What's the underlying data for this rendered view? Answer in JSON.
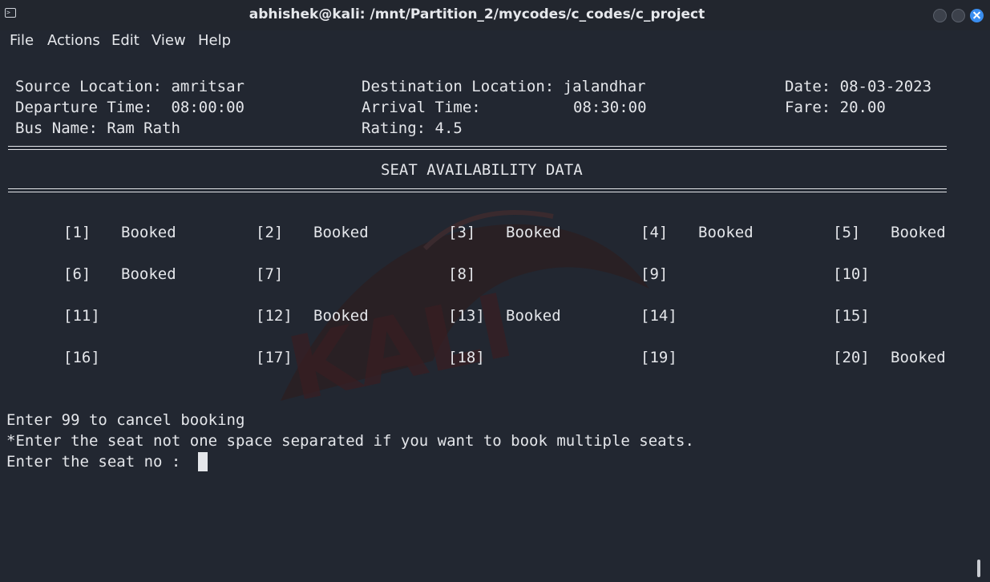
{
  "window": {
    "title": "abhishek@kali: /mnt/Partition_2/mycodes/c_codes/c_project"
  },
  "menu": {
    "file": "File",
    "actions": "Actions",
    "edit": "Edit",
    "view": "View",
    "help": "Help"
  },
  "trip": {
    "source": "Source Location: amritsar",
    "destination": "Destination Location: jalandhar",
    "date": "Date: 08-03-2023",
    "departure": "Departure Time:  08:00:00",
    "arrival_label": "Arrival Time:",
    "arrival_value": "08:30:00",
    "fare": "Fare: 20.00",
    "bus_name": "Bus Name: Ram Rath",
    "rating": "Rating: 4.5"
  },
  "section_title": "SEAT AVAILABILITY DATA",
  "seats": [
    {
      "no": "[1]",
      "status": "Booked"
    },
    {
      "no": "[2]",
      "status": "Booked"
    },
    {
      "no": "[3]",
      "status": "Booked"
    },
    {
      "no": "[4]",
      "status": "Booked"
    },
    {
      "no": "[5]",
      "status": "Booked"
    },
    {
      "no": "[6]",
      "status": "Booked"
    },
    {
      "no": "[7]",
      "status": ""
    },
    {
      "no": "[8]",
      "status": ""
    },
    {
      "no": "[9]",
      "status": ""
    },
    {
      "no": "[10]",
      "status": ""
    },
    {
      "no": "[11]",
      "status": ""
    },
    {
      "no": "[12]",
      "status": "Booked"
    },
    {
      "no": "[13]",
      "status": "Booked"
    },
    {
      "no": "[14]",
      "status": ""
    },
    {
      "no": "[15]",
      "status": ""
    },
    {
      "no": "[16]",
      "status": ""
    },
    {
      "no": "[17]",
      "status": ""
    },
    {
      "no": "[18]",
      "status": ""
    },
    {
      "no": "[19]",
      "status": ""
    },
    {
      "no": "[20]",
      "status": "Booked"
    }
  ],
  "prompt": {
    "cancel_hint": "Enter 99 to cancel booking",
    "multi_hint": "*Enter the seat not one space separated if you want to book multiple seats.",
    "input_prompt": "Enter the seat no : "
  },
  "colors": {
    "background": "#222731",
    "text": "#e4e6ea",
    "close_button": "#3a8ef0"
  }
}
